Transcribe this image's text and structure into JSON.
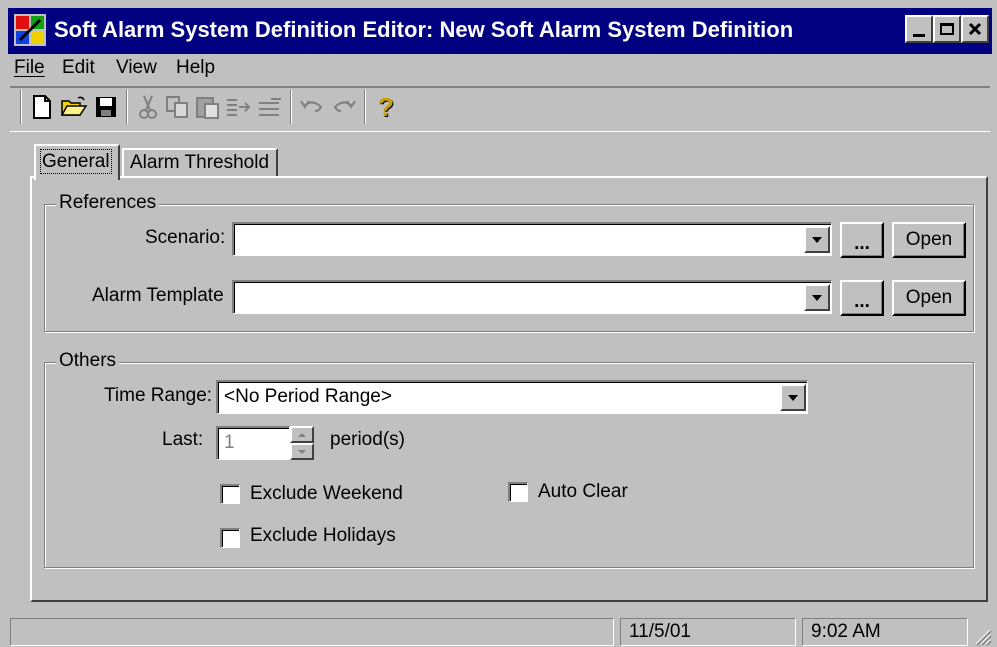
{
  "window": {
    "title": "Soft Alarm System Definition Editor: New Soft Alarm System Definition",
    "minimize_glyph": "_",
    "maximize_glyph": "□",
    "close_glyph": "×"
  },
  "menu": {
    "items": [
      {
        "label": "File"
      },
      {
        "label": "Edit"
      },
      {
        "label": "View"
      },
      {
        "label": "Help"
      }
    ]
  },
  "toolbar": {
    "icons": [
      "new-document-icon",
      "open-folder-icon",
      "save-icon",
      "cut-icon",
      "copy-icon",
      "paste-icon",
      "indent-icon",
      "outdent-icon",
      "undo-icon",
      "redo-icon",
      "help-icon"
    ],
    "help_glyph": "?"
  },
  "tabs": [
    {
      "label": "General",
      "active": true
    },
    {
      "label": "Alarm Threshold",
      "active": false
    }
  ],
  "references": {
    "legend": "References",
    "scenario_label": "Scenario:",
    "scenario_value": "",
    "template_label": "Alarm Template",
    "template_value": "",
    "browse_label": "...",
    "open_label": "Open"
  },
  "others": {
    "legend": "Others",
    "time_range_label": "Time Range:",
    "time_range_value": "<No Period Range>",
    "last_label": "Last:",
    "last_value": "1",
    "period_label": "period(s)",
    "exclude_weekend_label": "Exclude Weekend",
    "exclude_weekend_checked": false,
    "exclude_holidays_label": "Exclude Holidays",
    "exclude_holidays_checked": false,
    "auto_clear_label": "Auto Clear",
    "auto_clear_checked": false
  },
  "status": {
    "main": "",
    "date": "11/5/01",
    "time": "9:02 AM"
  },
  "colors": {
    "titlebar": "#000080",
    "face": "#c0c0c0"
  }
}
